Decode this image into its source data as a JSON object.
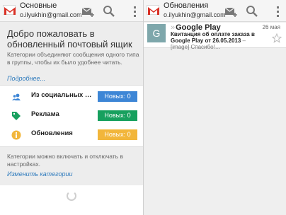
{
  "left": {
    "header": {
      "title": "Основные",
      "account": "o.ilyukhin@gmail.com"
    },
    "welcome": {
      "title": "Добро пожаловать в обновленный почтовый ящик",
      "text": "Категории объединяют сообщения одного типа в группы, чтобы их было удобнее читать.",
      "link": "Подробнее..."
    },
    "categories": [
      {
        "label": "Из социальных се…",
        "badge": "Новых: 0",
        "icon": "people-icon",
        "color": "#3d86d6"
      },
      {
        "label": "Реклама",
        "badge": "Новых: 0",
        "icon": "tag-icon",
        "color": "#17a05e"
      },
      {
        "label": "Обновления",
        "badge": "Новых: 0",
        "icon": "info-icon",
        "color": "#f2b63b"
      }
    ],
    "hint": {
      "text": "Категории можно включать и отключать в настройках.",
      "link": "Изменить категории"
    }
  },
  "right": {
    "header": {
      "title": "Обновления",
      "account": "o.ilyukhin@gmail.com"
    },
    "messages": [
      {
        "avatar": "G",
        "sender": "Google Play",
        "subject": "Квитанция об оплате заказа в Google Play от 26.05.2013",
        "snippet": " – [image] Спасибо!…",
        "date": "26 мая",
        "starred": false
      }
    ]
  },
  "colors": {
    "gmail_red": "#d93025",
    "link": "#2f7bbd",
    "avatar": "#7ea7ab"
  }
}
